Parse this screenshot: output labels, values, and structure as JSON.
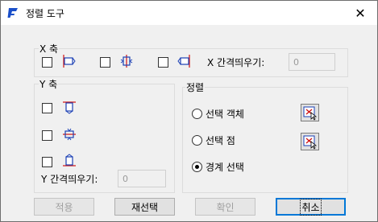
{
  "window": {
    "title": "정렬 도구",
    "app_icon": "app-logo-icon",
    "close_label": "✕"
  },
  "x_axis": {
    "label": "X 축",
    "options": [
      {
        "icon": "align-left-icon",
        "checked": false
      },
      {
        "icon": "align-center-x-icon",
        "checked": false
      },
      {
        "icon": "align-right-icon",
        "checked": false
      }
    ],
    "spacing_label": "X 간격띄우기:",
    "spacing_value": "0"
  },
  "y_axis": {
    "label": "Y 축",
    "options": [
      {
        "icon": "align-top-icon",
        "checked": false
      },
      {
        "icon": "align-middle-y-icon",
        "checked": false
      },
      {
        "icon": "align-bottom-icon",
        "checked": false
      }
    ],
    "spacing_label": "Y 간격띄우기:",
    "spacing_value": "0"
  },
  "align": {
    "label": "정렬",
    "radios": [
      {
        "label": "선택 객체",
        "selected": false,
        "has_pick": true
      },
      {
        "label": "선택 점",
        "selected": false,
        "has_pick": true
      },
      {
        "label": "경계 선택",
        "selected": true,
        "has_pick": false
      }
    ]
  },
  "buttons": {
    "apply": "적용",
    "reselect": "재선택",
    "ok": "확인",
    "cancel": "취소"
  },
  "colors": {
    "accent": "#0078d7",
    "icon_red": "#d01010",
    "icon_blue": "#1a3fb5"
  }
}
